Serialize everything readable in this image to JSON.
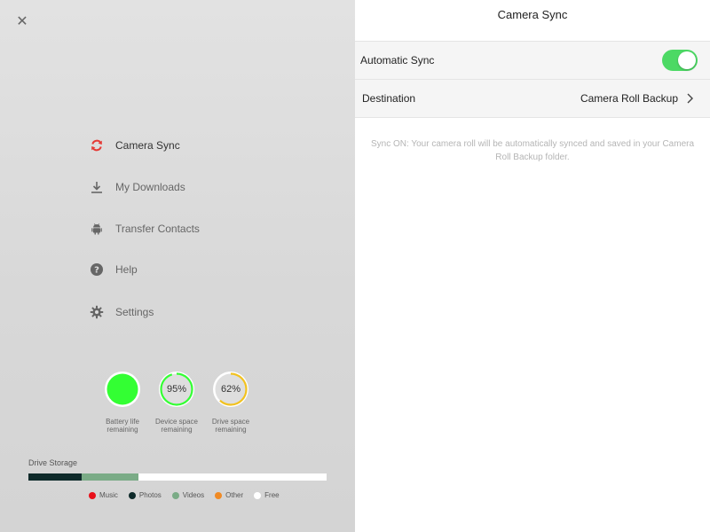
{
  "left_panel": {
    "close_icon": "close-icon",
    "menu": [
      {
        "id": "camera-sync",
        "label": "Camera Sync",
        "icon": "sync-icon",
        "active": true,
        "color": "#e53935"
      },
      {
        "id": "my-downloads",
        "label": "My Downloads",
        "icon": "download-icon",
        "active": false
      },
      {
        "id": "transfer-contacts",
        "label": "Transfer Contacts",
        "icon": "android-icon",
        "active": false
      },
      {
        "id": "help",
        "label": "Help",
        "icon": "help-icon",
        "active": false
      },
      {
        "id": "settings",
        "label": "Settings",
        "icon": "gear-icon",
        "active": false
      }
    ],
    "gauges": [
      {
        "id": "battery",
        "label_line1": "Battery life",
        "label_line2": "remaining",
        "value": 1.0,
        "text": "",
        "color": "#33ff33"
      },
      {
        "id": "device",
        "label_line1": "Device space",
        "label_line2": "remaining",
        "value": 0.95,
        "text": "95%",
        "color": "#33ff33"
      },
      {
        "id": "drive",
        "label_line1": "Drive space",
        "label_line2": "remaining",
        "value": 0.62,
        "text": "62%",
        "color": "#f2c21f"
      }
    ],
    "storage": {
      "title": "Drive Storage",
      "segments": [
        {
          "name": "Photos",
          "fraction": 0.18,
          "color": "#0e2a2a"
        },
        {
          "name": "Videos",
          "fraction": 0.19,
          "color": "#7aab86"
        },
        {
          "name": "Free",
          "fraction": 0.63,
          "color": "#ffffff"
        }
      ],
      "legend": [
        {
          "name": "Music",
          "color": "#e8101a"
        },
        {
          "name": "Photos",
          "color": "#0e2a2a"
        },
        {
          "name": "Videos",
          "color": "#7aab86"
        },
        {
          "name": "Other",
          "color": "#f08a24"
        },
        {
          "name": "Free",
          "color": "#ffffff"
        }
      ]
    }
  },
  "right_panel": {
    "title": "Camera Sync",
    "automatic_sync": {
      "label": "Automatic Sync",
      "enabled": true,
      "accent": "#4cd964"
    },
    "destination": {
      "label": "Destination",
      "value": "Camera Roll Backup",
      "icon": "chevron-right-icon"
    },
    "note": "Sync ON: Your camera roll will be automatically synced and saved in your Camera Roll Backup folder."
  }
}
